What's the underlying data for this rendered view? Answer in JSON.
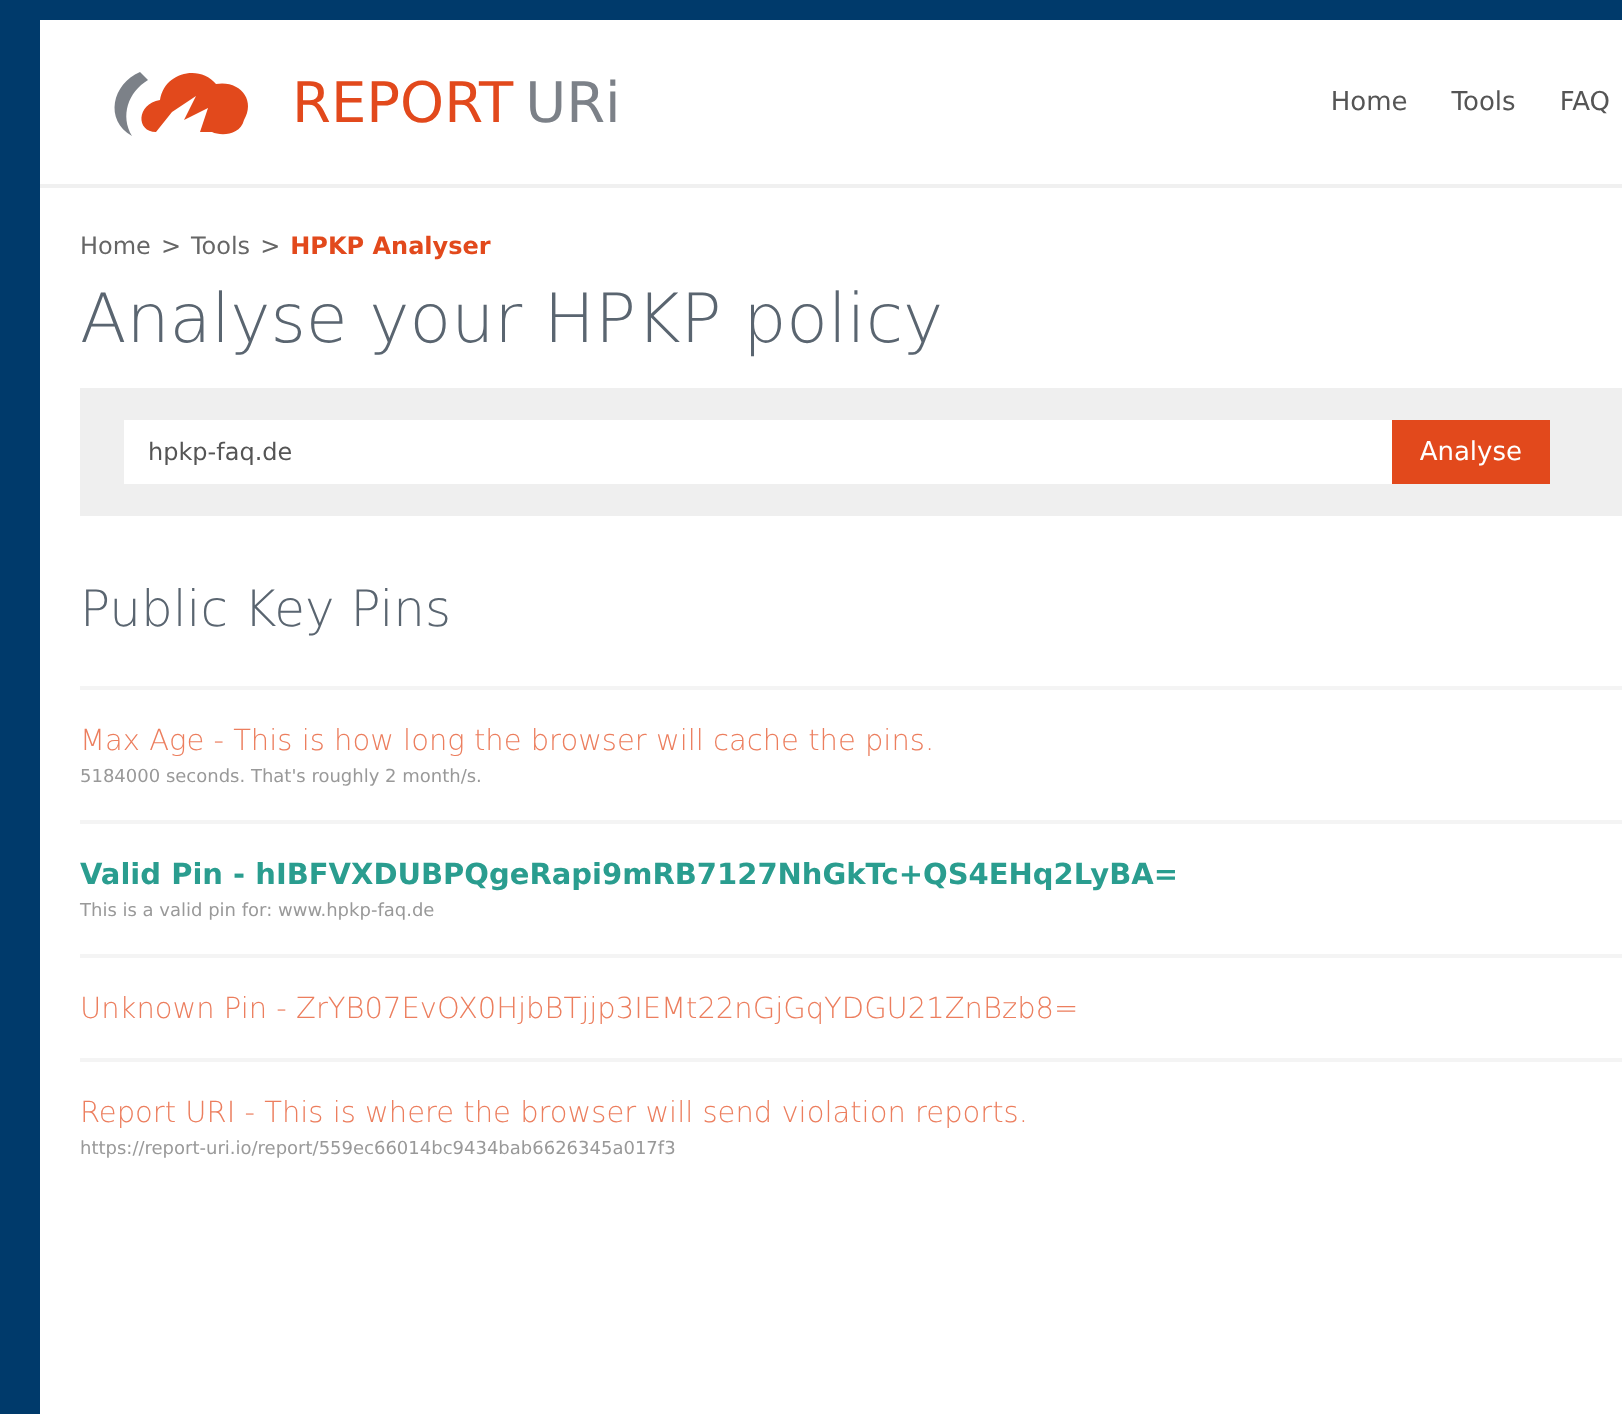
{
  "header": {
    "logo": {
      "word_1": "REPORT",
      "word_2": "URi"
    },
    "nav": [
      {
        "label": "Home"
      },
      {
        "label": "Tools"
      },
      {
        "label": "FAQ"
      }
    ]
  },
  "breadcrumb": [
    {
      "label": "Home",
      "current": false
    },
    {
      "separator": ">",
      "label": "Tools",
      "current": false
    },
    {
      "separator": ">",
      "label": "HPKP Analyser",
      "current": true
    }
  ],
  "title": "Analyse your HPKP policy",
  "search": {
    "value": "hpkp-faq.de",
    "button": "Analyse"
  },
  "section_title": "Public Key Pins",
  "results": [
    {
      "kind": "warning",
      "title": "Max Age - This is how long the browser will cache the pins.",
      "detail": "5184000 seconds. That's roughly 2 month/s."
    },
    {
      "kind": "valid",
      "title": "Valid Pin - hIBFVXDUBPQgeRapi9mRB7127NhGkTc+QS4EHq2LyBA=",
      "detail": "This is a valid pin for: www.hpkp-faq.de"
    },
    {
      "kind": "warning",
      "title": "Unknown Pin - ZrYB07EvOX0HjbBTjjp3IEMt22nGjGqYDGU21ZnBzb8="
    },
    {
      "kind": "warning",
      "title": "Report URI - This is where the browser will send violation reports.",
      "detail": "https://report-uri.io/report/559ec66014bc9434bab6626345a017f3"
    }
  ]
}
